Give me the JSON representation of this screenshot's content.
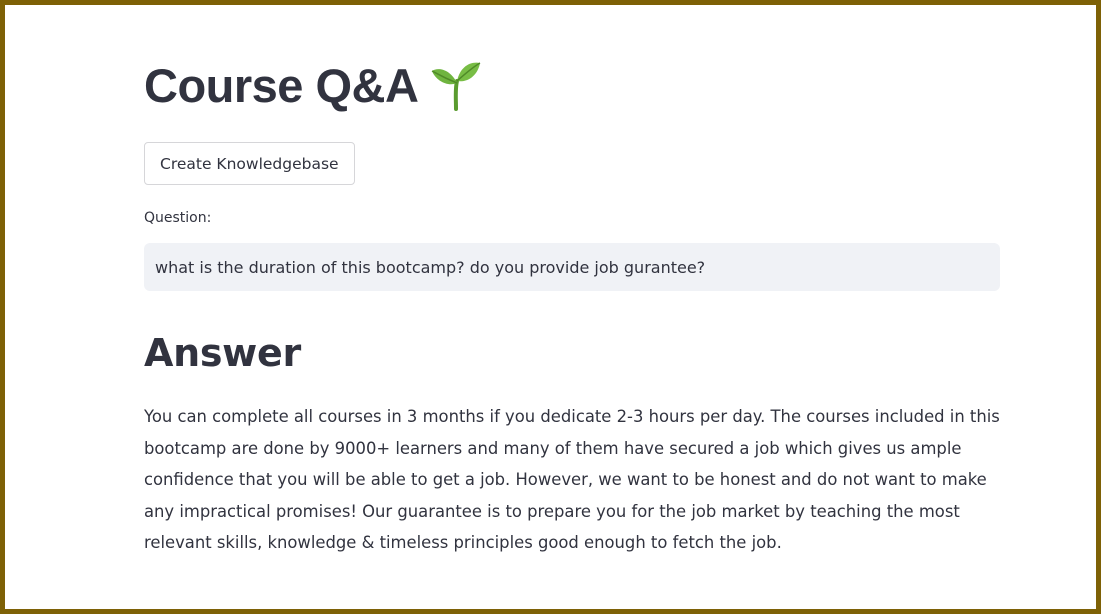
{
  "page": {
    "title": "Course Q&A",
    "title_icon": "sprout-icon"
  },
  "toolbar": {
    "create_kb_label": "Create Knowledgebase"
  },
  "question": {
    "label": "Question:",
    "value": "what is the duration of this bootcamp? do you provide job gurantee?"
  },
  "answer": {
    "heading": "Answer",
    "text": "You can complete all courses in 3 months if you dedicate 2-3 hours per day. The courses included in this bootcamp are done by 9000+ learners and many of them have secured a job which gives us ample confidence that you will be able to get a job. However, we want to be honest and do not want to make any impractical promises! Our guarantee is to prepare you for the job market by teaching the most relevant skills, knowledge & timeless principles good enough to fetch the job."
  },
  "colors": {
    "frame_border": "#7e6106",
    "text": "#31333f",
    "input_background": "#f0f2f6",
    "sprout_green": "#6fb43f"
  }
}
